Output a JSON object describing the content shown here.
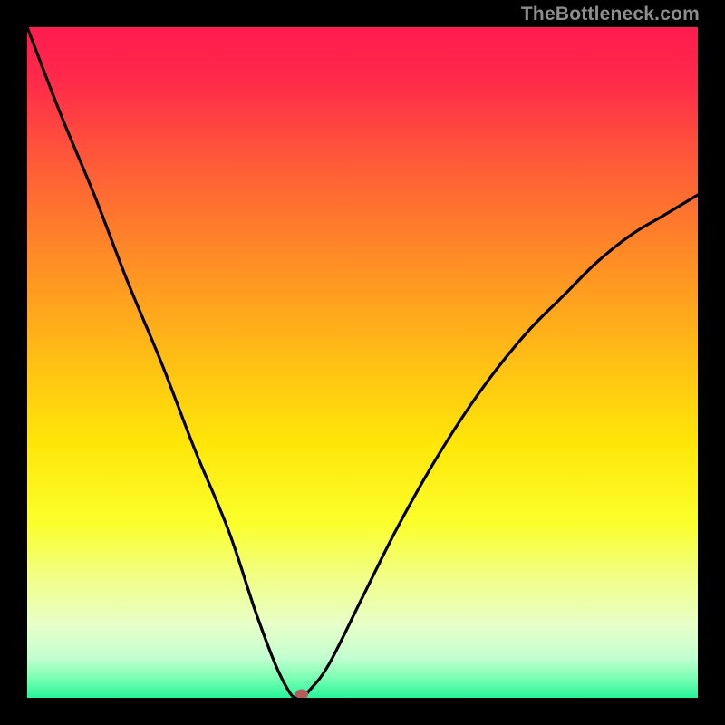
{
  "watermark": "TheBottleneck.com",
  "chart_data": {
    "type": "line",
    "title": "",
    "xlabel": "",
    "ylabel": "",
    "xlim": [
      0,
      100
    ],
    "ylim": [
      0,
      100
    ],
    "background_gradient": {
      "stops": [
        {
          "pct": 0,
          "color": "#ff1c4f"
        },
        {
          "pct": 8,
          "color": "#ff2a4a"
        },
        {
          "pct": 20,
          "color": "#ff5a38"
        },
        {
          "pct": 35,
          "color": "#ff8e25"
        },
        {
          "pct": 50,
          "color": "#ffc014"
        },
        {
          "pct": 62,
          "color": "#ffe608"
        },
        {
          "pct": 74,
          "color": "#fbff2b"
        },
        {
          "pct": 82,
          "color": "#f1ff86"
        },
        {
          "pct": 89,
          "color": "#e8ffc8"
        },
        {
          "pct": 94,
          "color": "#c3ffd0"
        },
        {
          "pct": 97,
          "color": "#7dffb4"
        },
        {
          "pct": 100,
          "color": "#26f49a"
        }
      ]
    },
    "series": [
      {
        "name": "bottleneck-curve",
        "color": "#000000",
        "x": [
          0,
          5,
          10,
          15,
          20,
          25,
          30,
          34,
          37,
          39,
          40,
          41,
          42,
          45,
          50,
          55,
          60,
          65,
          70,
          75,
          80,
          85,
          90,
          95,
          100
        ],
        "y": [
          100,
          87,
          75,
          62,
          50,
          37,
          25,
          13,
          5,
          1,
          0,
          0,
          1,
          5,
          15,
          25,
          34,
          42,
          49,
          55,
          60,
          65,
          69,
          72,
          75
        ]
      }
    ],
    "marker": {
      "x": 41,
      "y": 0.5,
      "color": "#b85a5a"
    }
  }
}
